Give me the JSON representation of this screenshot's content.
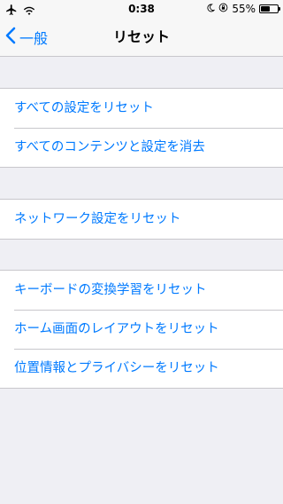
{
  "status_bar": {
    "time": "0:38",
    "battery_percent_text": "55%",
    "battery_level": 0.55,
    "icons": [
      "airplane-icon",
      "wifi-icon",
      "moon-icon",
      "rotation-lock-icon",
      "battery-icon"
    ]
  },
  "nav": {
    "back_label": "一般",
    "title": "リセット"
  },
  "groups": [
    {
      "items": [
        "すべての設定をリセット",
        "すべてのコンテンツと設定を消去"
      ]
    },
    {
      "items": [
        "ネットワーク設定をリセット"
      ]
    },
    {
      "items": [
        "キーボードの変換学習をリセット",
        "ホーム画面のレイアウトをリセット",
        "位置情報とプライバシーをリセット"
      ]
    }
  ],
  "colors": {
    "accent": "#007aff",
    "background": "#efeff4",
    "bar": "#f7f7f7",
    "separator": "#c8c7cc"
  }
}
